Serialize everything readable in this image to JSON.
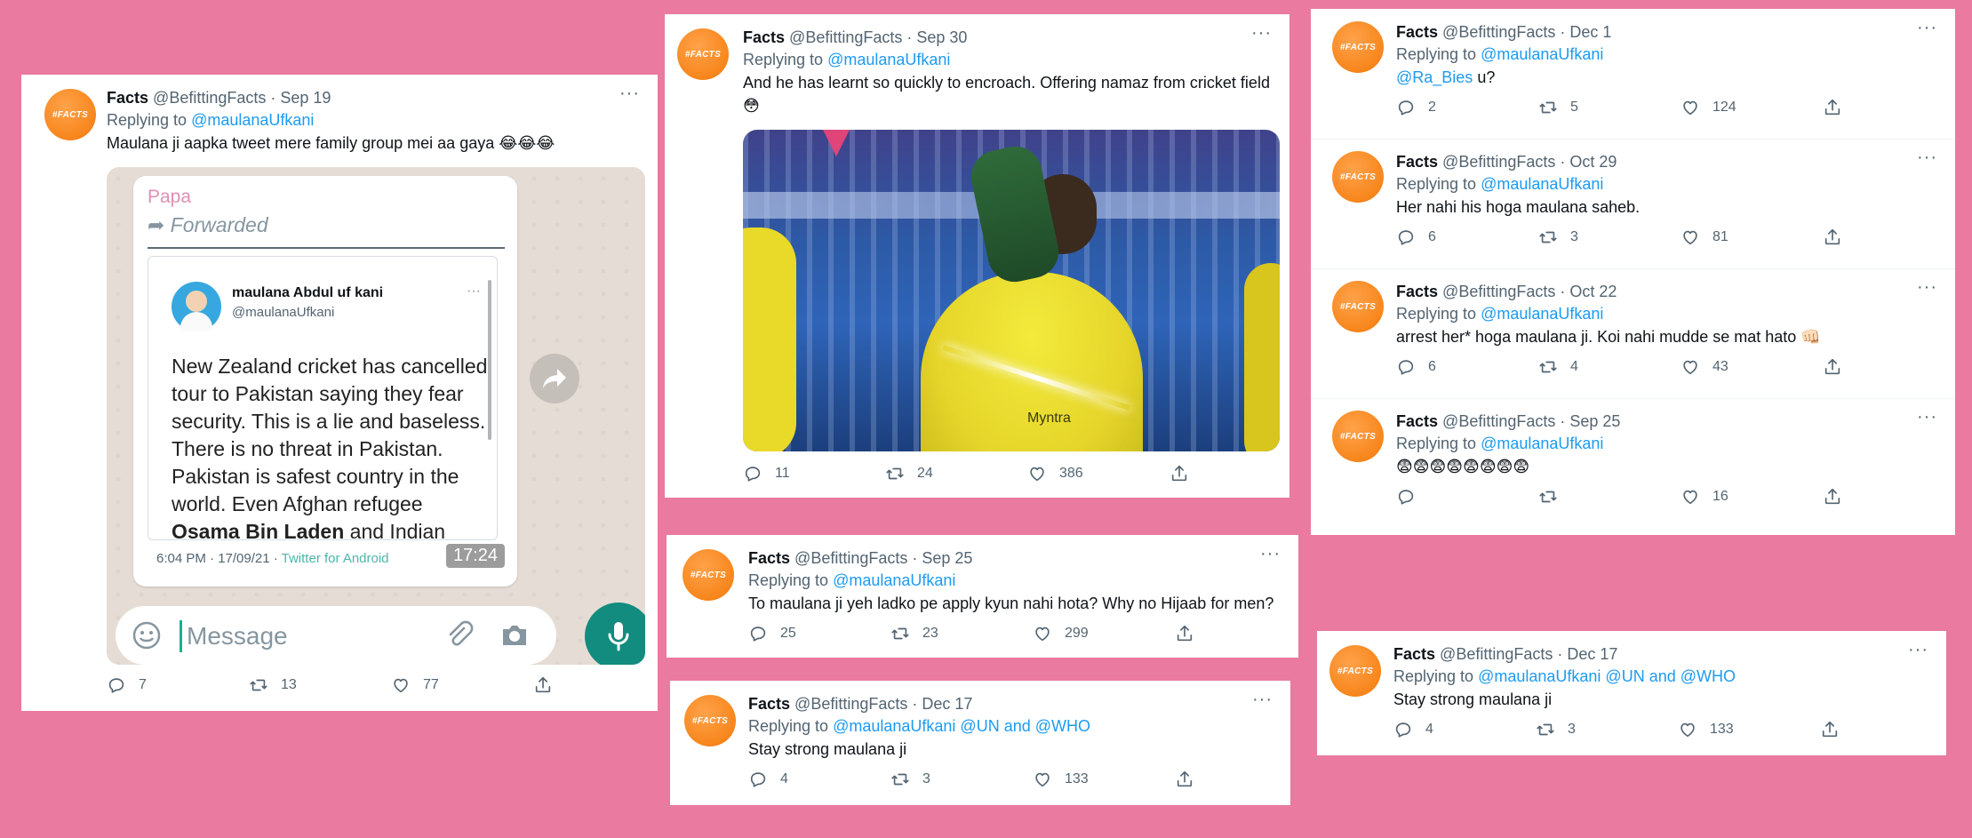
{
  "author": {
    "name": "Facts",
    "handle": "@BefittingFacts",
    "avatar_text": "#FACTS"
  },
  "replying_prefix": "Replying to",
  "tweet1": {
    "date": "Sep 19",
    "reply_to": "@maulanaUfkani",
    "text": "Maulana ji aapka tweet mere family group mei aa gaya 😂😂😂",
    "stats": {
      "replies": "7",
      "retweets": "13",
      "likes": "77"
    },
    "wa": {
      "sender": "Papa",
      "forwarded": "Forwarded",
      "inner_name": "maulana Abdul uf kani",
      "inner_handle": "@maulanaUfkani",
      "inner_text_1": "New Zealand cricket has cancelled tour to Pakistan saying they fear security. This is a lie and baseless. There is no threat in Pakistan. Pakistan is safest country in the world. Even Afghan refugee ",
      "inner_text_bold": "Osama Bin Laden",
      "inner_text_2": " and Indian refugee Dawood Ibrahim feel safe in Pakistan.",
      "inner_footer": "6:04 PM · 17/09/21 · ",
      "inner_source": "Twitter for Android",
      "time": "17:24",
      "placeholder": "Message"
    }
  },
  "tweet2": {
    "date": "Sep 30",
    "reply_to": "@maulanaUfkani",
    "text": "And he has learnt so quickly to encroach. Offering namaz from cricket field 😳",
    "image_caption": "Myntra",
    "stats": {
      "replies": "11",
      "retweets": "24",
      "likes": "386"
    }
  },
  "tweet3": {
    "date": "Sep 25",
    "reply_to": "@maulanaUfkani",
    "text": "To maulana ji yeh ladko pe apply kyun nahi hota? Why no Hijaab for men?",
    "stats": {
      "replies": "25",
      "retweets": "23",
      "likes": "299"
    }
  },
  "tweet4": {
    "date": "Dec 17",
    "reply_to": "@maulanaUfkani @UN and @WHO",
    "text": "Stay strong maulana ji",
    "stats": {
      "replies": "4",
      "retweets": "3",
      "likes": "133"
    }
  },
  "thread": [
    {
      "date": "Dec 1",
      "reply_to": "@maulanaUfkani",
      "text_link": "@Ra_Bies",
      "text": " u?",
      "stats": {
        "replies": "2",
        "retweets": "5",
        "likes": "124"
      }
    },
    {
      "date": "Oct 29",
      "reply_to": "@maulanaUfkani",
      "text_link": "",
      "text": "Her nahi his hoga maulana saheb.",
      "stats": {
        "replies": "6",
        "retweets": "3",
        "likes": "81"
      }
    },
    {
      "date": "Oct 22",
      "reply_to": "@maulanaUfkani",
      "text_link": "",
      "text": "arrest her* hoga maulana ji. Koi nahi mudde se mat hato 👊🏻",
      "stats": {
        "replies": "6",
        "retweets": "4",
        "likes": "43"
      }
    },
    {
      "date": "Sep 25",
      "reply_to": "@maulanaUfkani",
      "text_link": "",
      "text": "😨😨😨😨😨😨😨😨",
      "stats": {
        "replies": "",
        "retweets": "",
        "likes": "16"
      }
    }
  ],
  "tweet6": {
    "date": "Dec 17",
    "reply_to": "@maulanaUfkani @UN and @WHO",
    "text": "Stay strong maulana ji",
    "stats": {
      "replies": "4",
      "retweets": "3",
      "likes": "133"
    }
  }
}
